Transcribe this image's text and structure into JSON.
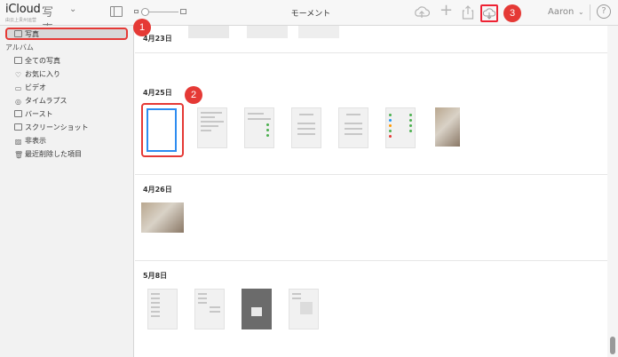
{
  "header": {
    "brand": "iCloud",
    "app": "写真",
    "subtitle": "由云上贵州运营",
    "title": "モーメント",
    "user": "Aaron",
    "help": "?"
  },
  "sidebar": {
    "selected": "写真",
    "section": "アルバム",
    "items": [
      {
        "label": "全ての写真",
        "icon": "photo-album-icon"
      },
      {
        "label": "お気に入り",
        "icon": "heart-icon"
      },
      {
        "label": "ビデオ",
        "icon": "video-icon"
      },
      {
        "label": "タイムラプス",
        "icon": "timelapse-icon"
      },
      {
        "label": "バースト",
        "icon": "burst-icon"
      },
      {
        "label": "スクリーンショット",
        "icon": "screenshot-icon"
      },
      {
        "label": "非表示",
        "icon": "hidden-icon"
      },
      {
        "label": "最近削除した項目",
        "icon": "trash-icon"
      }
    ]
  },
  "sections": [
    {
      "label": "4月23日"
    },
    {
      "label": "4月25日"
    },
    {
      "label": "4月26日"
    },
    {
      "label": "5月8日"
    }
  ],
  "markers": [
    "1",
    "2",
    "3"
  ],
  "colors": {
    "accent": "#e53935",
    "sidebar_bg": "#f2f2f2",
    "selection_blue": "#2d8cf0"
  }
}
